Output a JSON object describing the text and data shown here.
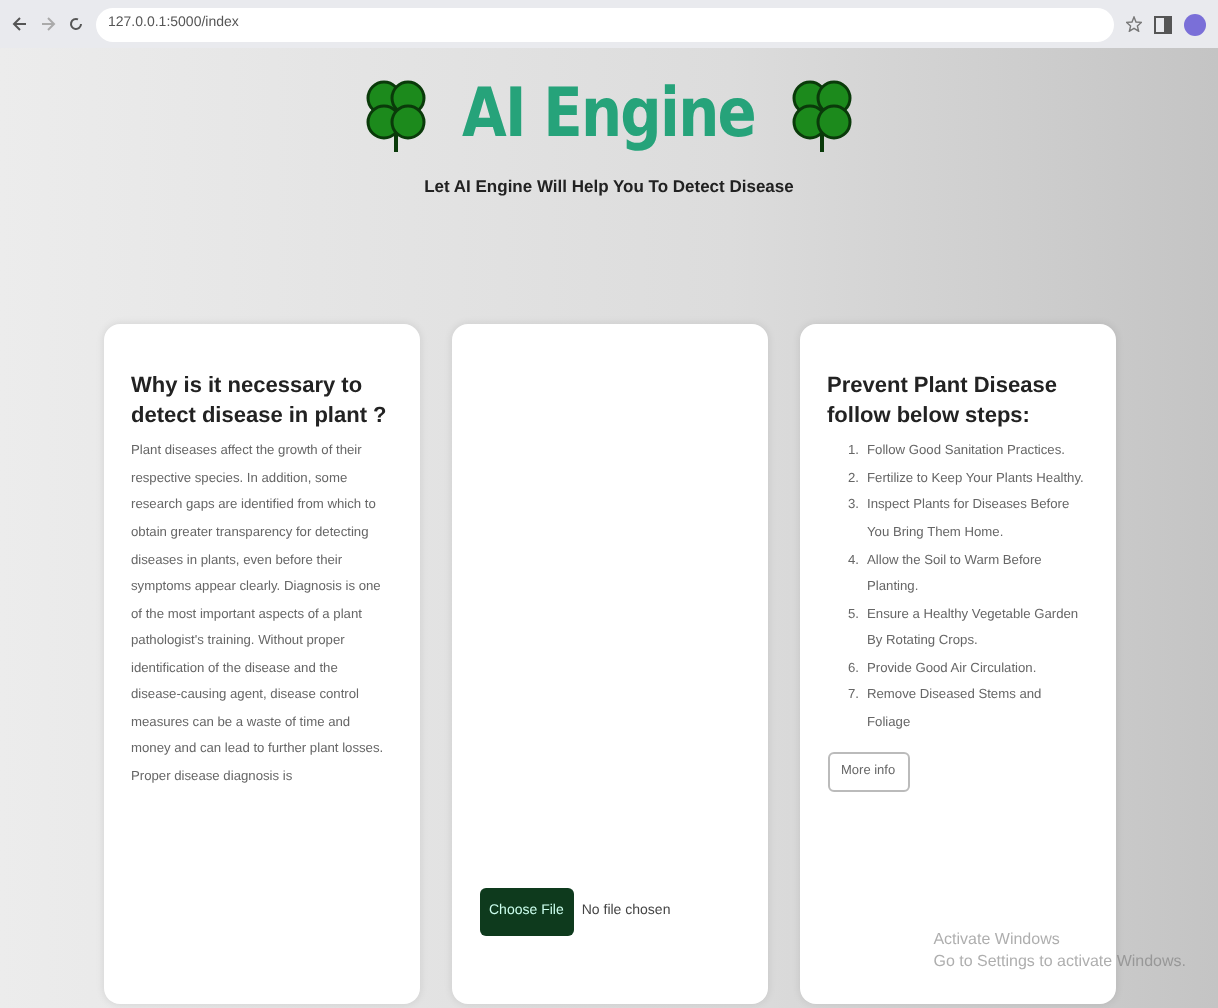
{
  "browser": {
    "address": "127.0.0.1:5000/index"
  },
  "header": {
    "title": "AI Engine",
    "subtitle": "Let AI Engine Will Help You To Detect Disease"
  },
  "info_card": {
    "heading": "Why is it necessary to detect disease in plant ?",
    "paragraph": "Plant diseases affect the growth of their respective species. In addition, some research gaps are identified from which to obtain greater transparency for detecting diseases in plants, even before their symptoms appear clearly. Diagnosis is one of the most important aspects of a plant pathologist's training. Without proper identification of the disease and the disease-causing agent, disease control measures can be a waste of time and money and can lead to further plant losses. Proper disease diagnosis is"
  },
  "upload_card": {
    "button": "Choose File",
    "file_status": "No file chosen"
  },
  "steps_card": {
    "heading": "Prevent Plant Disease follow below steps:",
    "steps": [
      {
        "number": "1.",
        "text": "Follow Good Sanitation Practices."
      },
      {
        "number": "2.",
        "text": "Fertilize to Keep Your Plants Healthy."
      },
      {
        "number": "3.",
        "text": "Inspect Plants for Diseases Before You Bring Them Home."
      },
      {
        "number": "4.",
        "text": "Allow the Soil to Warm Before Planting."
      },
      {
        "number": "5.",
        "text": "Ensure a Healthy Vegetable Garden By Rotating Crops."
      },
      {
        "number": "6.",
        "text": "Provide Good Air Circulation."
      },
      {
        "number": "7.",
        "text": "Remove Diseased Stems and Foliage"
      }
    ],
    "button": "More info"
  },
  "os_notice": {
    "title": "Activate Windows",
    "text": "Go to Settings to activate Windows."
  }
}
